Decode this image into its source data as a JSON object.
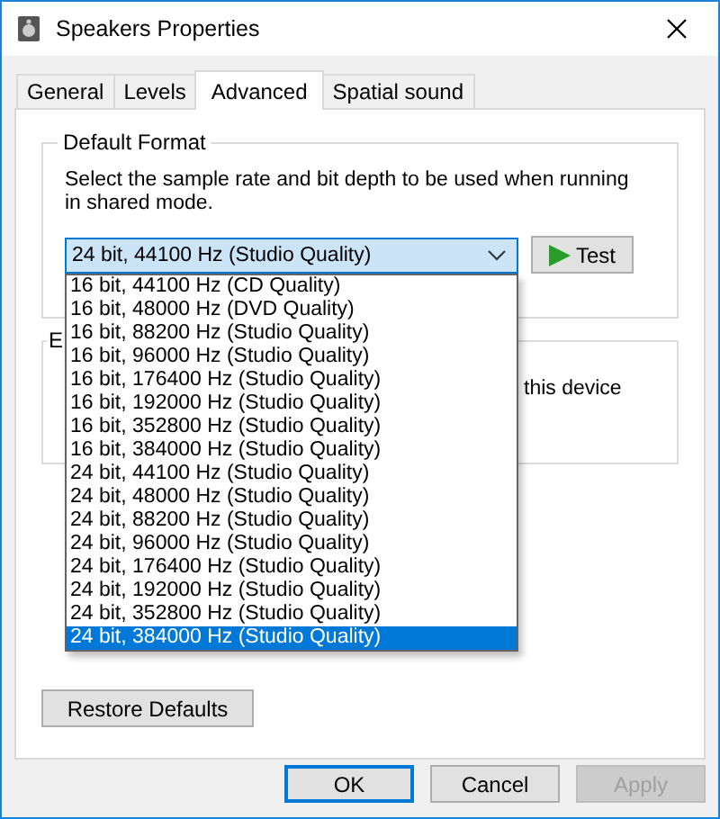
{
  "window": {
    "title": "Speakers Properties"
  },
  "tabs": [
    {
      "label": "General",
      "selected": false
    },
    {
      "label": "Levels",
      "selected": false
    },
    {
      "label": "Advanced",
      "selected": true
    },
    {
      "label": "Spatial sound",
      "selected": false
    }
  ],
  "default_format": {
    "title": "Default Format",
    "description": "Select the sample rate and bit depth to be used when running in shared mode.",
    "format_dropdown": {
      "value": "24 bit, 44100 Hz (Studio Quality)",
      "expanded": true,
      "options": [
        {
          "label": "16 bit, 44100 Hz (CD Quality)",
          "highlighted": false
        },
        {
          "label": "16 bit, 48000 Hz (DVD Quality)",
          "highlighted": false
        },
        {
          "label": "16 bit, 88200 Hz (Studio Quality)",
          "highlighted": false
        },
        {
          "label": "16 bit, 96000 Hz (Studio Quality)",
          "highlighted": false
        },
        {
          "label": "16 bit, 176400 Hz (Studio Quality)",
          "highlighted": false
        },
        {
          "label": "16 bit, 192000 Hz (Studio Quality)",
          "highlighted": false
        },
        {
          "label": "16 bit, 352800 Hz (Studio Quality)",
          "highlighted": false
        },
        {
          "label": "16 bit, 384000 Hz (Studio Quality)",
          "highlighted": false
        },
        {
          "label": "24 bit, 44100 Hz (Studio Quality)",
          "highlighted": false
        },
        {
          "label": "24 bit, 48000 Hz (Studio Quality)",
          "highlighted": false
        },
        {
          "label": "24 bit, 88200 Hz (Studio Quality)",
          "highlighted": false
        },
        {
          "label": "24 bit, 96000 Hz (Studio Quality)",
          "highlighted": false
        },
        {
          "label": "24 bit, 176400 Hz (Studio Quality)",
          "highlighted": false
        },
        {
          "label": "24 bit, 192000 Hz (Studio Quality)",
          "highlighted": false
        },
        {
          "label": "24 bit, 352800 Hz (Studio Quality)",
          "highlighted": false
        },
        {
          "label": "24 bit, 384000 Hz (Studio Quality)",
          "highlighted": true
        }
      ]
    },
    "test_button": "Test"
  },
  "exclusive_mode": {
    "title": "E",
    "text": "this device"
  },
  "restore_defaults_button": "Restore Defaults",
  "buttons": [
    {
      "label": "OK",
      "default": true,
      "disabled": false
    },
    {
      "label": "Cancel",
      "default": false,
      "disabled": false
    },
    {
      "label": "Apply",
      "default": false,
      "disabled": true
    }
  ]
}
